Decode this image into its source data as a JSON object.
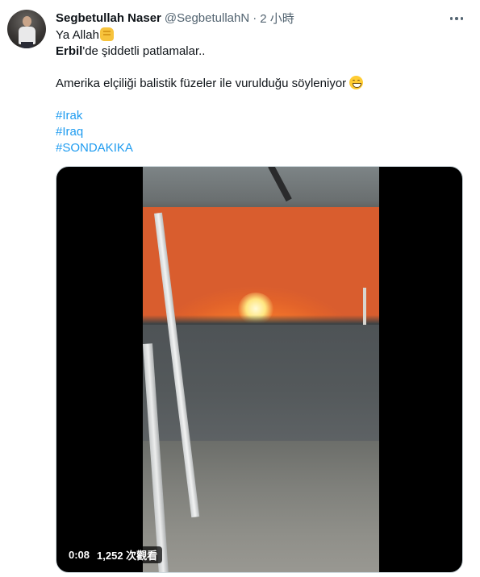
{
  "tweet": {
    "author_name": "Segbetullah Naser",
    "author_handle": "@SegbetullahN",
    "separator": "·",
    "time": "2 小時",
    "line1_text": "Ya Allah",
    "line1_emoji_icon": "raised-fist-emoji",
    "line2_bold": "Erbil",
    "line2_rest": "'de şiddetli patlamalar..",
    "line3_text": "Amerika elçiliği balistik füzeler ile vurulduğu söyleniyor",
    "line3_emoji_icon": "grinning-face-emoji",
    "hashtags": [
      "#Irak",
      "#Iraq",
      "#SONDAKIKA"
    ],
    "more_icon": "more-horizontal-icon"
  },
  "video": {
    "time": "0:08",
    "views": "1,252 次觀看"
  },
  "colors": {
    "link": "#1d9bf0",
    "secondary_text": "#536471",
    "primary_text": "#0f1419"
  }
}
